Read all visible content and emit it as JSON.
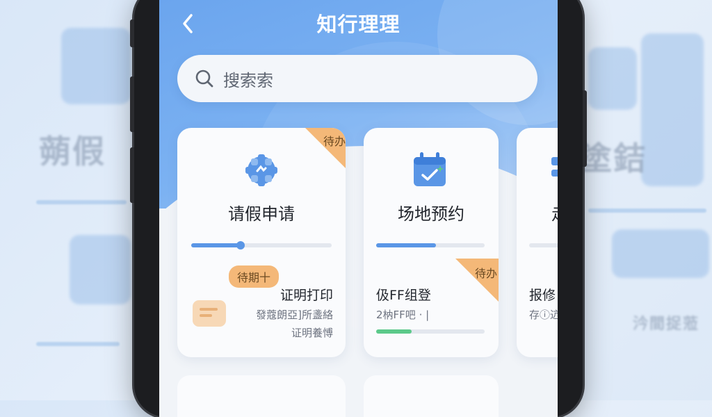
{
  "header": {
    "title": "知行理理"
  },
  "search": {
    "placeholder": "搜索索"
  },
  "cards": [
    {
      "title": "请假申请",
      "badge": "待办",
      "progress": 0.35,
      "progress_color": "#5a96e6",
      "sub_pill": "待期十",
      "sub_title": "证明打印",
      "sub_lines": [
        "發蔻朗亞]所盞絡",
        "证明養愽"
      ]
    },
    {
      "title": "场地预约",
      "badge": "待办",
      "progress": 0.55,
      "progress_color": "#5a96e6",
      "sub_title": "伋FF组登",
      "sub_lines": [
        "2枘FF吧 · |"
      ],
      "sub_progress": 0.33,
      "sub_progress_color": "#5cc98a"
    },
    {
      "title": "走",
      "sub_title": "报修",
      "sub_lines": [
        "存ⓘ迒"
      ]
    }
  ],
  "background": {
    "left_text": "蒴假",
    "right_text": "塗銡",
    "right_small": "汵間捉蒞"
  },
  "colors": {
    "primary": "#6ba5ee",
    "badge": "#f4b878",
    "accent_green": "#5cc98a"
  }
}
